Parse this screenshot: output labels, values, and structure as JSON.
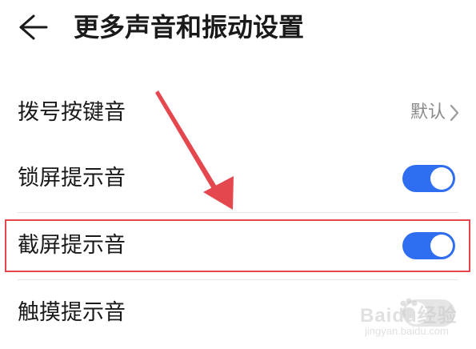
{
  "header": {
    "title": "更多声音和振动设置",
    "back_icon": "arrow-left-icon"
  },
  "rows": [
    {
      "label": "拨号按键音",
      "value": "默认",
      "control": "chevron-right-icon"
    },
    {
      "label": "锁屏提示音",
      "control": "toggle",
      "checked": true
    },
    {
      "label": "截屏提示音",
      "control": "toggle",
      "checked": true,
      "highlighted": true
    },
    {
      "label": "触摸提示音",
      "control": "toggle",
      "checked": false
    }
  ],
  "annotation": {
    "arrow_color": "#e4474e",
    "highlight_color": "#e4474e"
  },
  "watermark": {
    "logo": "Baidu经验",
    "url": "jingyan.baidu.com"
  },
  "colors": {
    "accent": "#2f6ef1",
    "text": "#1a1a1a",
    "secondary_text": "#8a8a8a",
    "divider": "#e6e6e6"
  }
}
